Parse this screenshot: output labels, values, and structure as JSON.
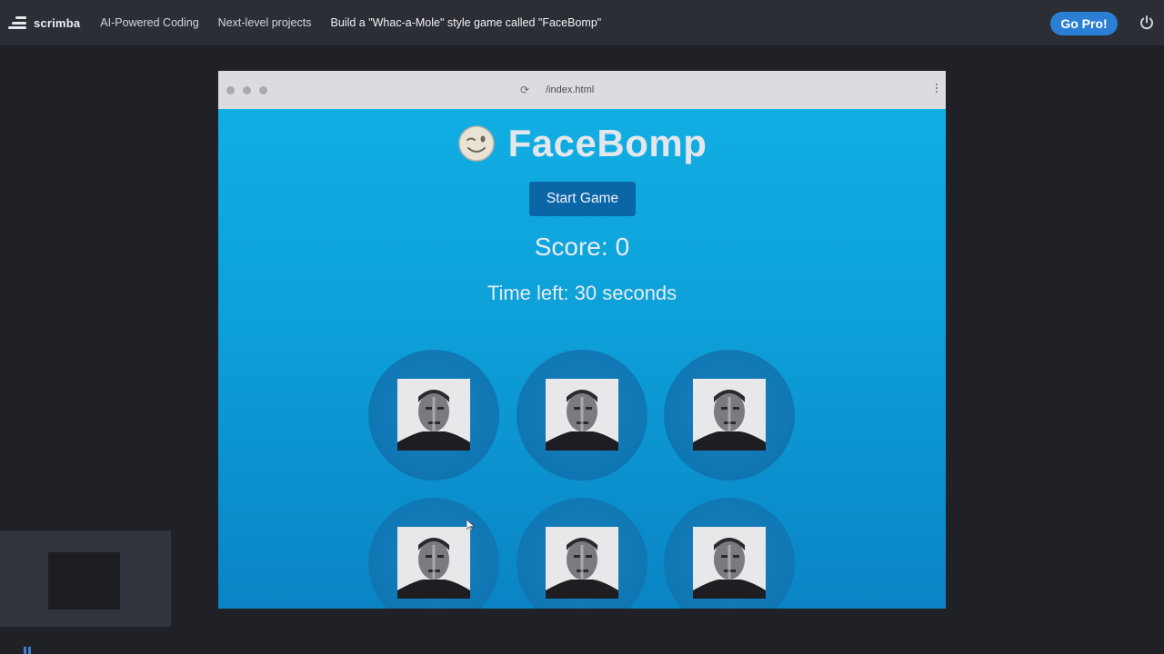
{
  "app": {
    "logo_text": "scrimba"
  },
  "nav": {
    "crumbs": [
      "AI-Powered Coding",
      "Next-level projects",
      "Build a \"Whac-a-Mole\" style game called \"FaceBomp\""
    ],
    "gopro_label": "Go Pro!"
  },
  "browser": {
    "url": "/index.html",
    "reload_glyph": "⟳"
  },
  "game": {
    "title": "FaceBomp",
    "start_label": "Start Game",
    "score_label": "Score:",
    "score_value": "0",
    "time_label": "Time left:",
    "time_value": "30",
    "time_unit": "seconds",
    "holes": 6
  },
  "colors": {
    "game_bg": "#11aee3",
    "button_bg": "#0b66a8",
    "gopro_bg": "#2a7fd5",
    "topbar_bg": "#2b2e35"
  },
  "icons": [
    "scrimba-logo-icon",
    "power-icon",
    "reload-icon",
    "menu-dots-icon",
    "winking-face-icon",
    "face-image",
    "cursor-icon",
    "pause-icon"
  ]
}
